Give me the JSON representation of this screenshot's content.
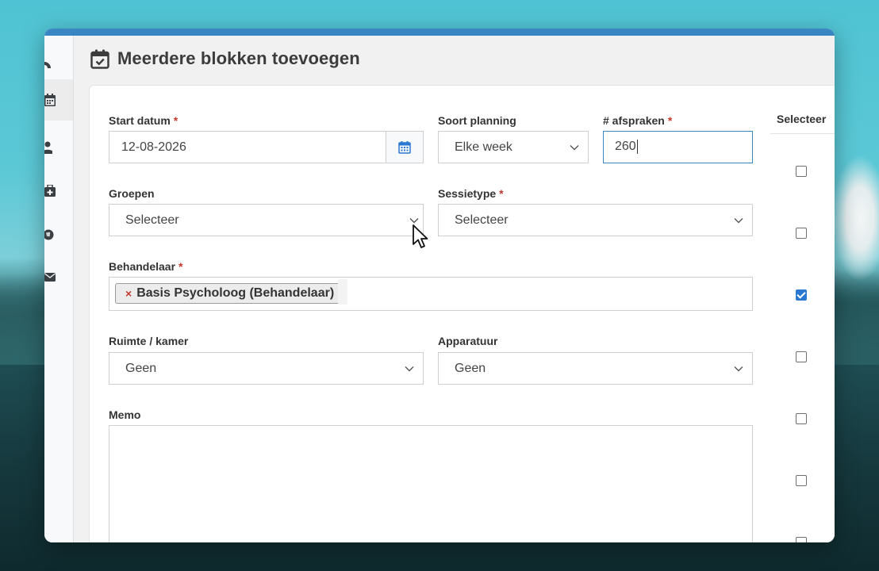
{
  "page": {
    "title": "Meerdere blokken toevoegen"
  },
  "sidebar": {
    "items": [
      {
        "icon": "dashboard-icon",
        "active": false
      },
      {
        "icon": "calendar-icon",
        "active": true
      },
      {
        "icon": "user-icon",
        "active": false
      },
      {
        "icon": "medical-kit-icon",
        "active": false
      },
      {
        "icon": "globe-icon",
        "active": false
      },
      {
        "icon": "envelope-icon",
        "active": false
      }
    ]
  },
  "form": {
    "start_date": {
      "label": "Start datum",
      "required": "*",
      "value": "12-08-2026"
    },
    "planning": {
      "label": "Soort planning",
      "value": "Elke week"
    },
    "appointments": {
      "label": "# afspraken",
      "required": "*",
      "value": "260"
    },
    "groups": {
      "label": "Groepen",
      "value": "Selecteer"
    },
    "session_type": {
      "label": "Sessietype",
      "required": "*",
      "value": "Selecteer"
    },
    "practitioner": {
      "label": "Behandelaar",
      "required": "*",
      "tag": "Basis Psycholoog (Behandelaar)",
      "remove": "×"
    },
    "room": {
      "label": "Ruimte / kamer",
      "value": "Geen"
    },
    "equipment": {
      "label": "Apparatuur",
      "value": "Geen"
    },
    "memo": {
      "label": "Memo",
      "value": ""
    }
  },
  "select_column": {
    "header": "Selecteer",
    "checkboxes": [
      false,
      false,
      true,
      false,
      false,
      false,
      false
    ]
  },
  "colors": {
    "accent": "#3a86c2",
    "required": "#c0392b",
    "checkbox": "#2b78d0"
  }
}
